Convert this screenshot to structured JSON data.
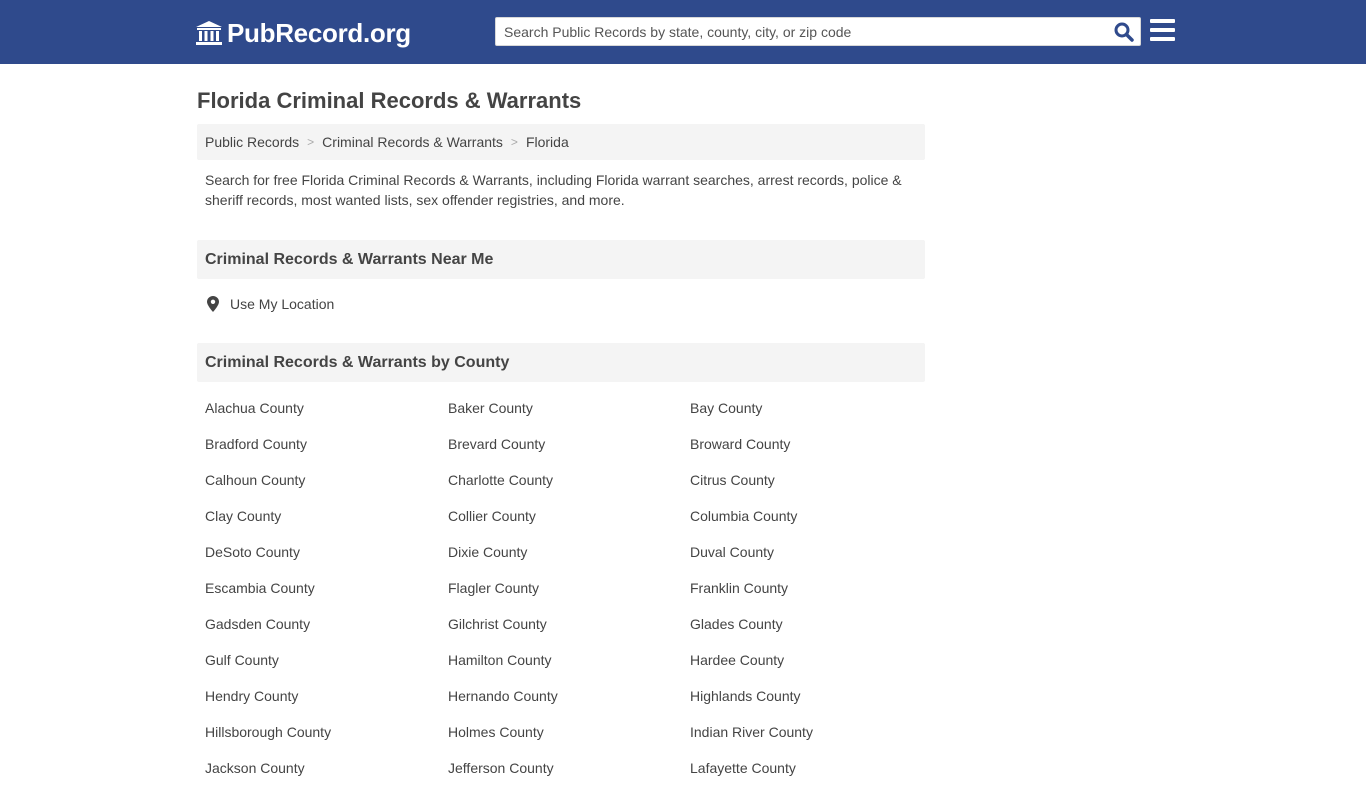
{
  "header": {
    "logo_text": "PubRecord.org",
    "logo_icon": "courthouse-icon",
    "search_placeholder": "Search Public Records by state, county, city, or zip code",
    "search_icon": "search-icon",
    "menu_icon": "hamburger-menu-icon"
  },
  "page": {
    "title": "Florida Criminal Records & Warrants",
    "intro": "Search for free Florida Criminal Records & Warrants, including Florida warrant searches, arrest records, police & sheriff records, most wanted lists, sex offender registries, and more."
  },
  "breadcrumb": {
    "items": [
      "Public Records",
      "Criminal Records & Warrants",
      "Florida"
    ],
    "separator": ">"
  },
  "near_me": {
    "heading": "Criminal Records & Warrants Near Me",
    "location_label": "Use My Location",
    "location_icon": "map-marker-icon"
  },
  "by_county": {
    "heading": "Criminal Records & Warrants by County",
    "counties": [
      "Alachua County",
      "Baker County",
      "Bay County",
      "Bradford County",
      "Brevard County",
      "Broward County",
      "Calhoun County",
      "Charlotte County",
      "Citrus County",
      "Clay County",
      "Collier County",
      "Columbia County",
      "DeSoto County",
      "Dixie County",
      "Duval County",
      "Escambia County",
      "Flagler County",
      "Franklin County",
      "Gadsden County",
      "Gilchrist County",
      "Glades County",
      "Gulf County",
      "Hamilton County",
      "Hardee County",
      "Hendry County",
      "Hernando County",
      "Highlands County",
      "Hillsborough County",
      "Holmes County",
      "Indian River County",
      "Jackson County",
      "Jefferson County",
      "Lafayette County"
    ]
  },
  "colors": {
    "header_bg": "#2f4a8c",
    "section_bg": "#f4f4f4",
    "text": "#444444",
    "search_icon": "#2f4a8c"
  }
}
